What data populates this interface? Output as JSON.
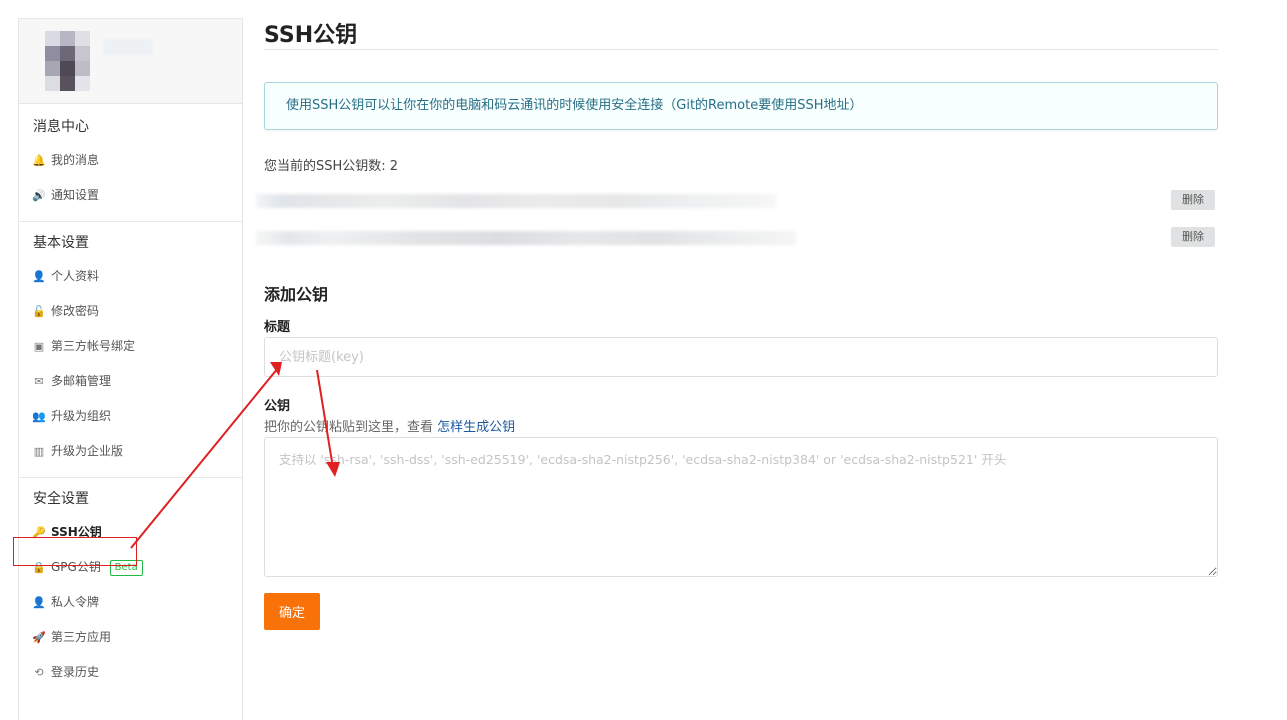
{
  "sidebar": {
    "sections": [
      {
        "title": "消息中心",
        "items": [
          {
            "label": "我的消息",
            "icon": "bell-icon",
            "glyph": "🔔"
          },
          {
            "label": "通知设置",
            "icon": "speaker-icon",
            "glyph": "🔊"
          }
        ]
      },
      {
        "title": "基本设置",
        "items": [
          {
            "label": "个人资料",
            "icon": "user-icon",
            "glyph": "👤"
          },
          {
            "label": "修改密码",
            "icon": "unlock-icon",
            "glyph": "🔓"
          },
          {
            "label": "第三方帐号绑定",
            "icon": "id-card-icon",
            "glyph": "▣"
          },
          {
            "label": "多邮箱管理",
            "icon": "mail-icon",
            "glyph": "✉"
          },
          {
            "label": "升级为组织",
            "icon": "users-icon",
            "glyph": "👥"
          },
          {
            "label": "升级为企业版",
            "icon": "building-icon",
            "glyph": "▥"
          }
        ]
      },
      {
        "title": "安全设置",
        "items": [
          {
            "label": "SSH公钥",
            "icon": "key-icon",
            "glyph": "🔑"
          },
          {
            "label": "GPG公钥",
            "icon": "lock-icon",
            "glyph": "🔒",
            "badge": "Beta"
          },
          {
            "label": "私人令牌",
            "icon": "spy-icon",
            "glyph": "👤"
          },
          {
            "label": "第三方应用",
            "icon": "rocket-icon",
            "glyph": "🚀"
          },
          {
            "label": "登录历史",
            "icon": "history-icon",
            "glyph": "⟲"
          }
        ]
      }
    ]
  },
  "main": {
    "title": "SSH公钥",
    "info": "使用SSH公钥可以让你在你的电脑和码云通讯的时候使用安全连接（Git的Remote要使用SSH地址）",
    "key_count_label": "您当前的SSH公钥数: 2",
    "keys": [
      {
        "delete_label": "删除"
      },
      {
        "delete_label": "删除"
      }
    ],
    "add_title": "添加公钥",
    "title_label": "标题",
    "title_placeholder": "公钥标题(key)",
    "key_label": "公钥",
    "key_hint": "把你的公钥粘贴到这里，查看 ",
    "key_hint_link": "怎样生成公钥",
    "key_placeholder": "支持以 'ssh-rsa', 'ssh-dss', 'ssh-ed25519', 'ecdsa-sha2-nistp256', 'ecdsa-sha2-nistp384' or 'ecdsa-sha2-nistp521' 开头",
    "submit_label": "确定"
  },
  "colors": {
    "accent": "#f97109",
    "info_text": "#276f86",
    "annotation": "#e02020",
    "beta": "#21ba45"
  }
}
